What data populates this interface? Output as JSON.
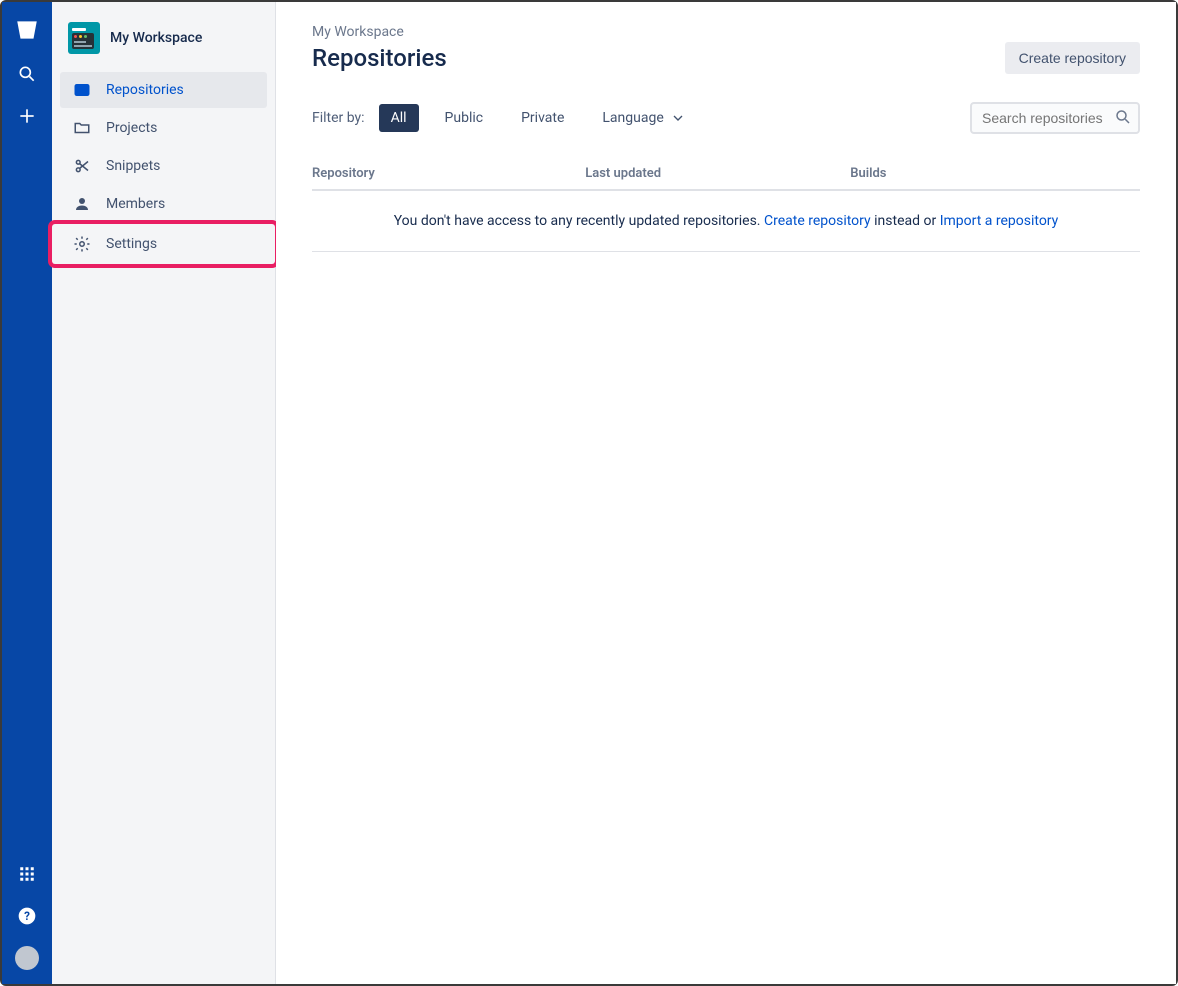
{
  "rail": {
    "logo": "bitbucket-logo"
  },
  "workspace": {
    "name": "My Workspace"
  },
  "sidebar": {
    "items": [
      {
        "label": "Repositories",
        "icon": "code-icon",
        "active": true
      },
      {
        "label": "Projects",
        "icon": "folder-icon",
        "active": false
      },
      {
        "label": "Snippets",
        "icon": "scissors-icon",
        "active": false
      },
      {
        "label": "Members",
        "icon": "person-icon",
        "active": false
      },
      {
        "label": "Settings",
        "icon": "gear-icon",
        "active": false,
        "highlighted": true
      }
    ]
  },
  "main": {
    "breadcrumb": "My Workspace",
    "title": "Repositories",
    "create_button": "Create repository",
    "filter_label": "Filter by:",
    "filters": {
      "all": "All",
      "public": "Public",
      "private": "Private",
      "language": "Language"
    },
    "search_placeholder": "Search repositories",
    "columns": {
      "repository": "Repository",
      "last_updated": "Last updated",
      "builds": "Builds"
    },
    "empty": {
      "prefix": "You don't have access to any recently updated repositories. ",
      "create_link": "Create repository",
      "middle": " instead or ",
      "import_link": "Import a repository"
    }
  }
}
